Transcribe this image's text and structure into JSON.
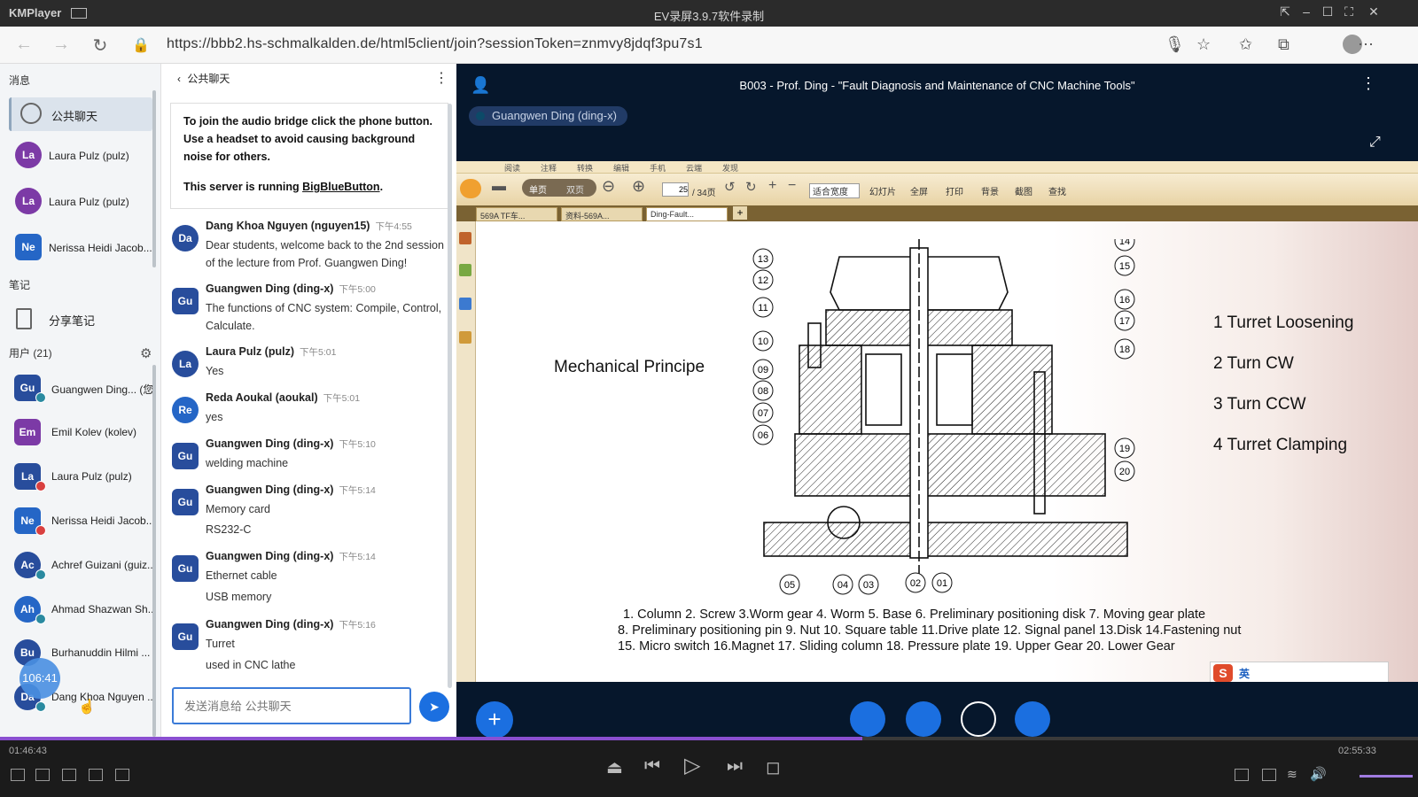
{
  "kmplayer": {
    "app_name": "KMPlayer",
    "window_title": "EV录屏3.9.7软件录制"
  },
  "browser": {
    "url": "https://bbb2.hs-schmalkalden.de/html5client/join?sessionToken=znmvy8jdqf3pu7s1"
  },
  "sidebar": {
    "messages_heading": "消息",
    "public_chat_label": "公共聊天",
    "private_chats": [
      {
        "initials": "La",
        "name": "Laura Pulz (pulz)"
      },
      {
        "initials": "La",
        "name": "Laura Pulz (pulz)"
      },
      {
        "initials": "Ne",
        "name": "Nerissa Heidi Jacob..."
      }
    ],
    "notes_heading": "笔记",
    "shared_notes_label": "分享笔记",
    "users_heading": "用户 (21)",
    "users": [
      {
        "initials": "Gu",
        "name": "Guangwen Ding... (您"
      },
      {
        "initials": "Em",
        "name": "Emil Kolev (kolev)"
      },
      {
        "initials": "La",
        "name": "Laura Pulz (pulz)"
      },
      {
        "initials": "Ne",
        "name": "Nerissa Heidi Jacob..."
      },
      {
        "initials": "Ac",
        "name": "Achref Guizani (guiz..."
      },
      {
        "initials": "Ah",
        "name": "Ahmad Shazwan Sh..."
      },
      {
        "initials": "Bu",
        "name": "Burhanuddin Hilmi ..."
      },
      {
        "initials": "Da",
        "name": "Dang Khoa Nguyen ..."
      }
    ],
    "timer": "106:41"
  },
  "chat": {
    "header": "公共聊天",
    "welcome_line1": "To join the audio bridge click the phone button. Use a headset to avoid causing background noise for others.",
    "welcome_line2_prefix": "This server is running ",
    "welcome_link": "BigBlueButton",
    "welcome_line2_suffix": ".",
    "messages": [
      {
        "initials": "Da",
        "name": "Dang Khoa Nguyen (nguyen15)",
        "time": "下午4:55",
        "lines": [
          "Dear students, welcome back to the 2nd session of the lecture from Prof. Guangwen Ding!"
        ]
      },
      {
        "initials": "Gu",
        "name": "Guangwen Ding (ding-x)",
        "time": "下午5:00",
        "lines": [
          "The functions of CNC system: Compile, Control, Calculate."
        ]
      },
      {
        "initials": "La",
        "name": "Laura Pulz (pulz)",
        "time": "下午5:01",
        "lines": [
          "Yes"
        ]
      },
      {
        "initials": "Re",
        "name": "Reda Aoukal (aoukal)",
        "time": "下午5:01",
        "lines": [
          "yes"
        ]
      },
      {
        "initials": "Gu",
        "name": "Guangwen Ding (ding-x)",
        "time": "下午5:10",
        "lines": [
          "welding machine"
        ]
      },
      {
        "initials": "Gu",
        "name": "Guangwen Ding (ding-x)",
        "time": "下午5:14",
        "lines": [
          "Memory card",
          "RS232-C"
        ]
      },
      {
        "initials": "Gu",
        "name": "Guangwen Ding (ding-x)",
        "time": "下午5:14",
        "lines": [
          "Ethernet cable",
          "USB memory"
        ]
      },
      {
        "initials": "Gu",
        "name": "Guangwen Ding (ding-x)",
        "time": "下午5:16",
        "lines": [
          "Turret",
          "used in CNC lathe"
        ]
      }
    ],
    "input_placeholder": "发送消息给 公共聊天"
  },
  "presentation": {
    "title": "B003 - Prof. Ding - \"Fault Diagnosis and Maintenance of CNC Machine Tools\"",
    "talker": "Guangwen Ding (ding-x)",
    "viewer": {
      "menu": [
        "阅读",
        "注释",
        "转换",
        "编辑",
        "手机",
        "云端",
        "发现"
      ],
      "page_input": "25",
      "page_total": "/ 34页",
      "toolbar_items": [
        "单页",
        "双页",
        "适合宽度",
        "幻灯片",
        "全屏",
        "打印",
        "背景",
        "截图",
        "查找"
      ],
      "tabs": [
        "569A TF车...",
        "资料-569A...",
        "Ding-Fault..."
      ]
    },
    "slide": {
      "left_title": "Mechanical Principe",
      "steps": [
        "1 Turret Loosening",
        "2 Turn CW",
        "3 Turn CCW",
        "4 Turret Clamping"
      ],
      "callouts_left": [
        "13",
        "12",
        "11",
        "10",
        "09",
        "08",
        "07",
        "06"
      ],
      "callouts_right": [
        "14",
        "15",
        "16",
        "17",
        "18",
        "19",
        "20"
      ],
      "callouts_bottom": [
        "05",
        "04",
        "03",
        "02",
        "01"
      ],
      "caption_lines": [
        "1. Column 2. Screw 3.Worm gear 4. Worm 5. Base 6. Preliminary positioning disk 7. Moving gear plate",
        " 8. Preliminary positioning pin 9. Nut 10. Square table 11.Drive plate 12. Signal panel 13.Disk 14.Fastening nut",
        "15. Micro switch  16.Magnet 17. Sliding column 18. Pressure plate 19. Upper Gear 20. Lower Gear"
      ]
    },
    "ime_label": "英"
  },
  "player": {
    "elapsed": "01:46:43",
    "total": "02:55:33",
    "progress_fraction": 0.6079
  }
}
